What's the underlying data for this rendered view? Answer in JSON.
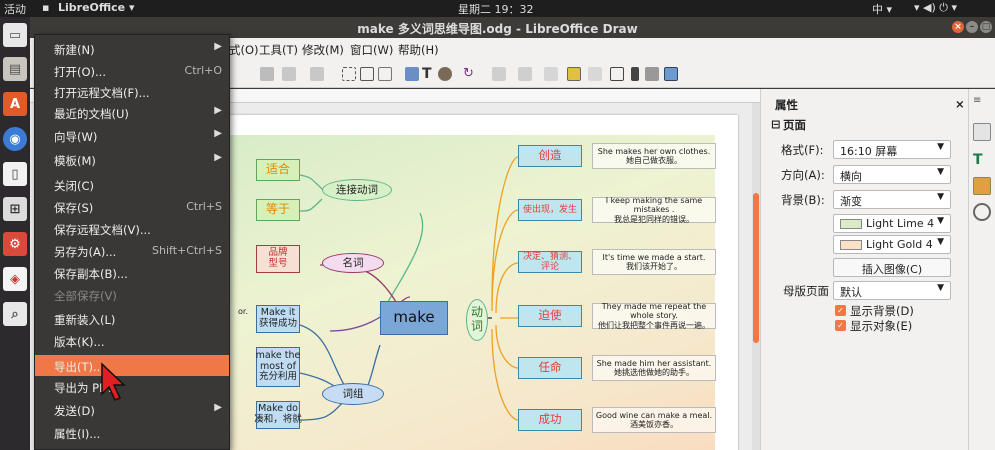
{
  "topbar": {
    "activities": "活动",
    "app": "LibreOffice ▾",
    "clock": "星期二 19：32",
    "input": "中 ▾",
    "status_icons": "▾ ◀) ⏻ ▾"
  },
  "window": {
    "title": "make 多义词思维导图.odg - LibreOffice Draw"
  },
  "menubar": {
    "items": [
      "式(O)",
      "工具(T)",
      "修改(M)",
      "窗口(W)",
      "帮助(H)"
    ]
  },
  "file_menu": {
    "items": [
      {
        "label": "新建(N)",
        "shortcut": "",
        "submenu": true
      },
      {
        "label": "打开(O)...",
        "shortcut": "Ctrl+O",
        "submenu": false
      },
      {
        "label": "打开远程文档(F)...",
        "shortcut": "",
        "submenu": false
      },
      {
        "label": "最近的文档(U)",
        "shortcut": "",
        "submenu": true
      },
      {
        "label": "向导(W)",
        "shortcut": "",
        "submenu": true
      },
      {
        "label": "模板(M)",
        "shortcut": "",
        "submenu": true
      },
      {
        "label": "关闭(C)",
        "shortcut": "",
        "submenu": false
      },
      {
        "label": "保存(S)",
        "shortcut": "Ctrl+S",
        "submenu": false
      },
      {
        "label": "保存远程文档(V)...",
        "shortcut": "",
        "submenu": false
      },
      {
        "label": "另存为(A)...",
        "shortcut": "Shift+Ctrl+S",
        "submenu": false
      },
      {
        "label": "保存副本(B)...",
        "shortcut": "",
        "submenu": false
      },
      {
        "label": "全部保存(V)",
        "shortcut": "",
        "submenu": false,
        "disabled": true
      },
      {
        "label": "重新装入(L)",
        "shortcut": "",
        "submenu": false
      },
      {
        "label": "版本(K)...",
        "shortcut": "",
        "submenu": false
      },
      {
        "label": "导出(T)...",
        "shortcut": "",
        "submenu": false,
        "highlighted": true
      },
      {
        "label": "导出为 PD...",
        "shortcut": "",
        "submenu": false
      },
      {
        "label": "发送(D)",
        "shortcut": "",
        "submenu": true
      },
      {
        "label": "属性(I)...",
        "shortcut": "",
        "submenu": false
      }
    ]
  },
  "diagram": {
    "center": "make",
    "verb_label": "动\n词",
    "ell_connect_verb": "连接动词",
    "ell_noun": "名词",
    "ell_phrase": "词组",
    "box_suit": "适合",
    "box_become": "等于",
    "box_brand": "品牌\n型号",
    "box_make_it": "Make it\n获得成功",
    "box_make_most": "make the\nmost of\n充分利用",
    "box_make_do": "Make do\n凑和，将就",
    "cut_text_1": "or.",
    "verbs": [
      {
        "word": "创造",
        "en": "She makes her own clothes.",
        "zh": "她自己做衣服。"
      },
      {
        "word": "使出现，发生",
        "en": "I keep making the same mistakes .",
        "zh": "我总是犯同样的错误。"
      },
      {
        "word": "决定、猜测、评论",
        "en": "It's time we made a start.",
        "zh": "我们该开始了。"
      },
      {
        "word": "迫使",
        "en": "They made me repeat the whole story.",
        "zh": "他们让我把整个事件再说一遍。"
      },
      {
        "word": "任命",
        "en": "She made him her assistant.",
        "zh": "她挑选他做她的助手。"
      },
      {
        "word": "成功",
        "en": "Good wine can make a meal.",
        "zh": "酒美饭亦香。"
      }
    ]
  },
  "sidebar": {
    "title": "属性",
    "section": "页面",
    "format_label": "格式(F):",
    "format_value": "16:10 屏幕",
    "orientation_label": "方向(A):",
    "orientation_value": "横向",
    "background_label": "背景(B):",
    "background_value": "渐变",
    "color1": "Light Lime 4",
    "color2": "Light Gold 4",
    "insert_image": "插入图像(C)",
    "master_label": "母版页面",
    "master_value": "默认",
    "show_bg": "显示背景(D)",
    "show_obj": "显示对象(E)",
    "colors": {
      "lime": "#d9ecc6",
      "gold": "#fbe1c6",
      "accent": "#f07746"
    }
  }
}
